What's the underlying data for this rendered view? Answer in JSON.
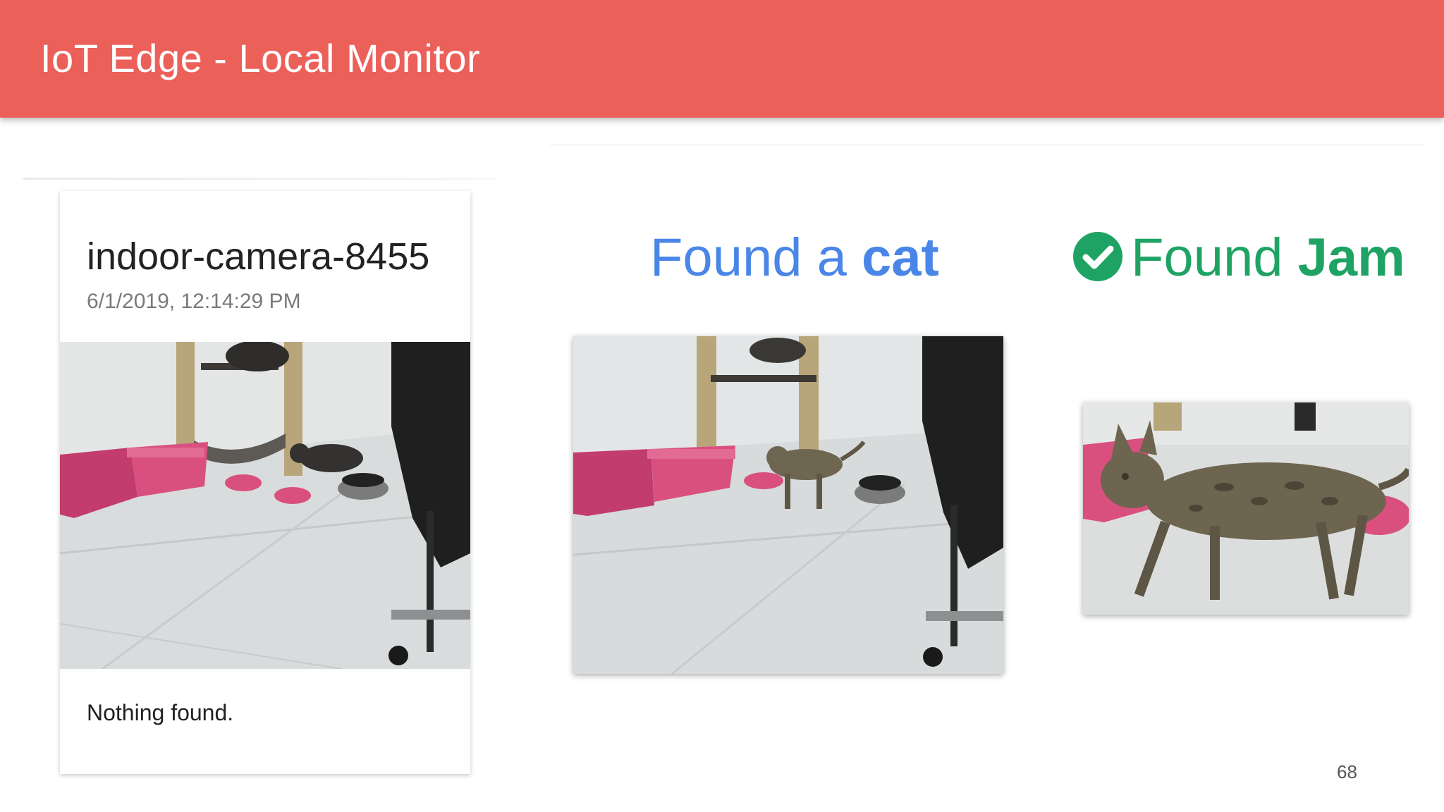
{
  "appbar": {
    "title": "IoT Edge - Local Monitor",
    "color": "#ec605a"
  },
  "card": {
    "title": "indoor-camera-8455",
    "timestamp": "6/1/2019, 12:14:29 PM",
    "status": "Nothing found."
  },
  "detections": [
    {
      "prefix": "Found a ",
      "label": "cat",
      "color": "#4a86e8"
    },
    {
      "prefix": "Found ",
      "label": "Jam",
      "color": "#1fa364",
      "icon": "check-circle-icon"
    }
  ],
  "slide": {
    "page_number": "68"
  }
}
